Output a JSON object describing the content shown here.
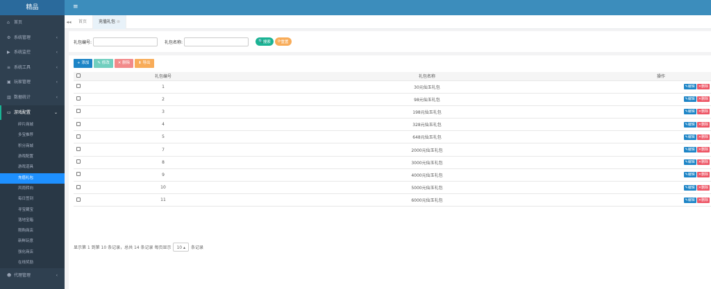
{
  "app": {
    "logo": "精品"
  },
  "topbar": {
    "menu_icon": "hamburger-icon"
  },
  "sidebar": {
    "items": [
      {
        "label": "首页",
        "icon": "home-icon",
        "has_chevron": false
      },
      {
        "label": "系统管理",
        "icon": "gear-icon",
        "has_chevron": true
      },
      {
        "label": "系统监控",
        "icon": "video-icon",
        "has_chevron": true
      },
      {
        "label": "系统工具",
        "icon": "bars-icon",
        "has_chevron": true
      },
      {
        "label": "玩家管理",
        "icon": "user-icon",
        "has_chevron": true
      },
      {
        "label": "数据统计",
        "icon": "chart-icon",
        "has_chevron": true
      },
      {
        "label": "游戏配置",
        "icon": "desktop-icon",
        "has_chevron": true,
        "expanded": true
      }
    ],
    "subitems": [
      "碎片商城",
      "多宝推荐",
      "积分商城",
      "游戏配置",
      "游戏道具",
      "充值礼包",
      "风雨转向",
      "每日签到",
      "寻宝藏宝",
      "落地宝箱",
      "限购商店",
      "新鲜玩意",
      "强化商店",
      "在线奖励"
    ],
    "active_sub_index": 5,
    "bottom_item": {
      "label": "代理管理",
      "icon": "users-icon"
    }
  },
  "tabs": {
    "left_nav": "◂◂",
    "items": [
      {
        "label": "首页",
        "active": false
      },
      {
        "label": "充值礼包",
        "active": true,
        "close": "⊗"
      }
    ]
  },
  "search": {
    "field1_label": "礼包编号:",
    "field2_label": "礼包名称:",
    "search_btn": "搜索",
    "reset_btn": "重置"
  },
  "toolbar": {
    "add": "添加",
    "edit": "修改",
    "delete": "删除",
    "export": "导出"
  },
  "table": {
    "headers": [
      "礼包编号",
      "礼包名称",
      "操作"
    ],
    "rows": [
      {
        "id": "1",
        "name": "30元仙玉礼包"
      },
      {
        "id": "2",
        "name": "98元仙玉礼包"
      },
      {
        "id": "3",
        "name": "198元仙玉礼包"
      },
      {
        "id": "4",
        "name": "328元仙玉礼包"
      },
      {
        "id": "5",
        "name": "648元仙玉礼包"
      },
      {
        "id": "7",
        "name": "2000元仙玉礼包"
      },
      {
        "id": "8",
        "name": "3000元仙玉礼包"
      },
      {
        "id": "9",
        "name": "4000元仙玉礼包"
      },
      {
        "id": "10",
        "name": "5000元仙玉礼包"
      },
      {
        "id": "11",
        "name": "6000元仙玉礼包"
      }
    ],
    "row_edit": "编辑",
    "row_delete": "删除"
  },
  "pager": {
    "prefix": "显示第 1 到第 10 条记录，总共 14 条记录 每页显示",
    "page_size": "10 ▴",
    "suffix": "条记录"
  }
}
